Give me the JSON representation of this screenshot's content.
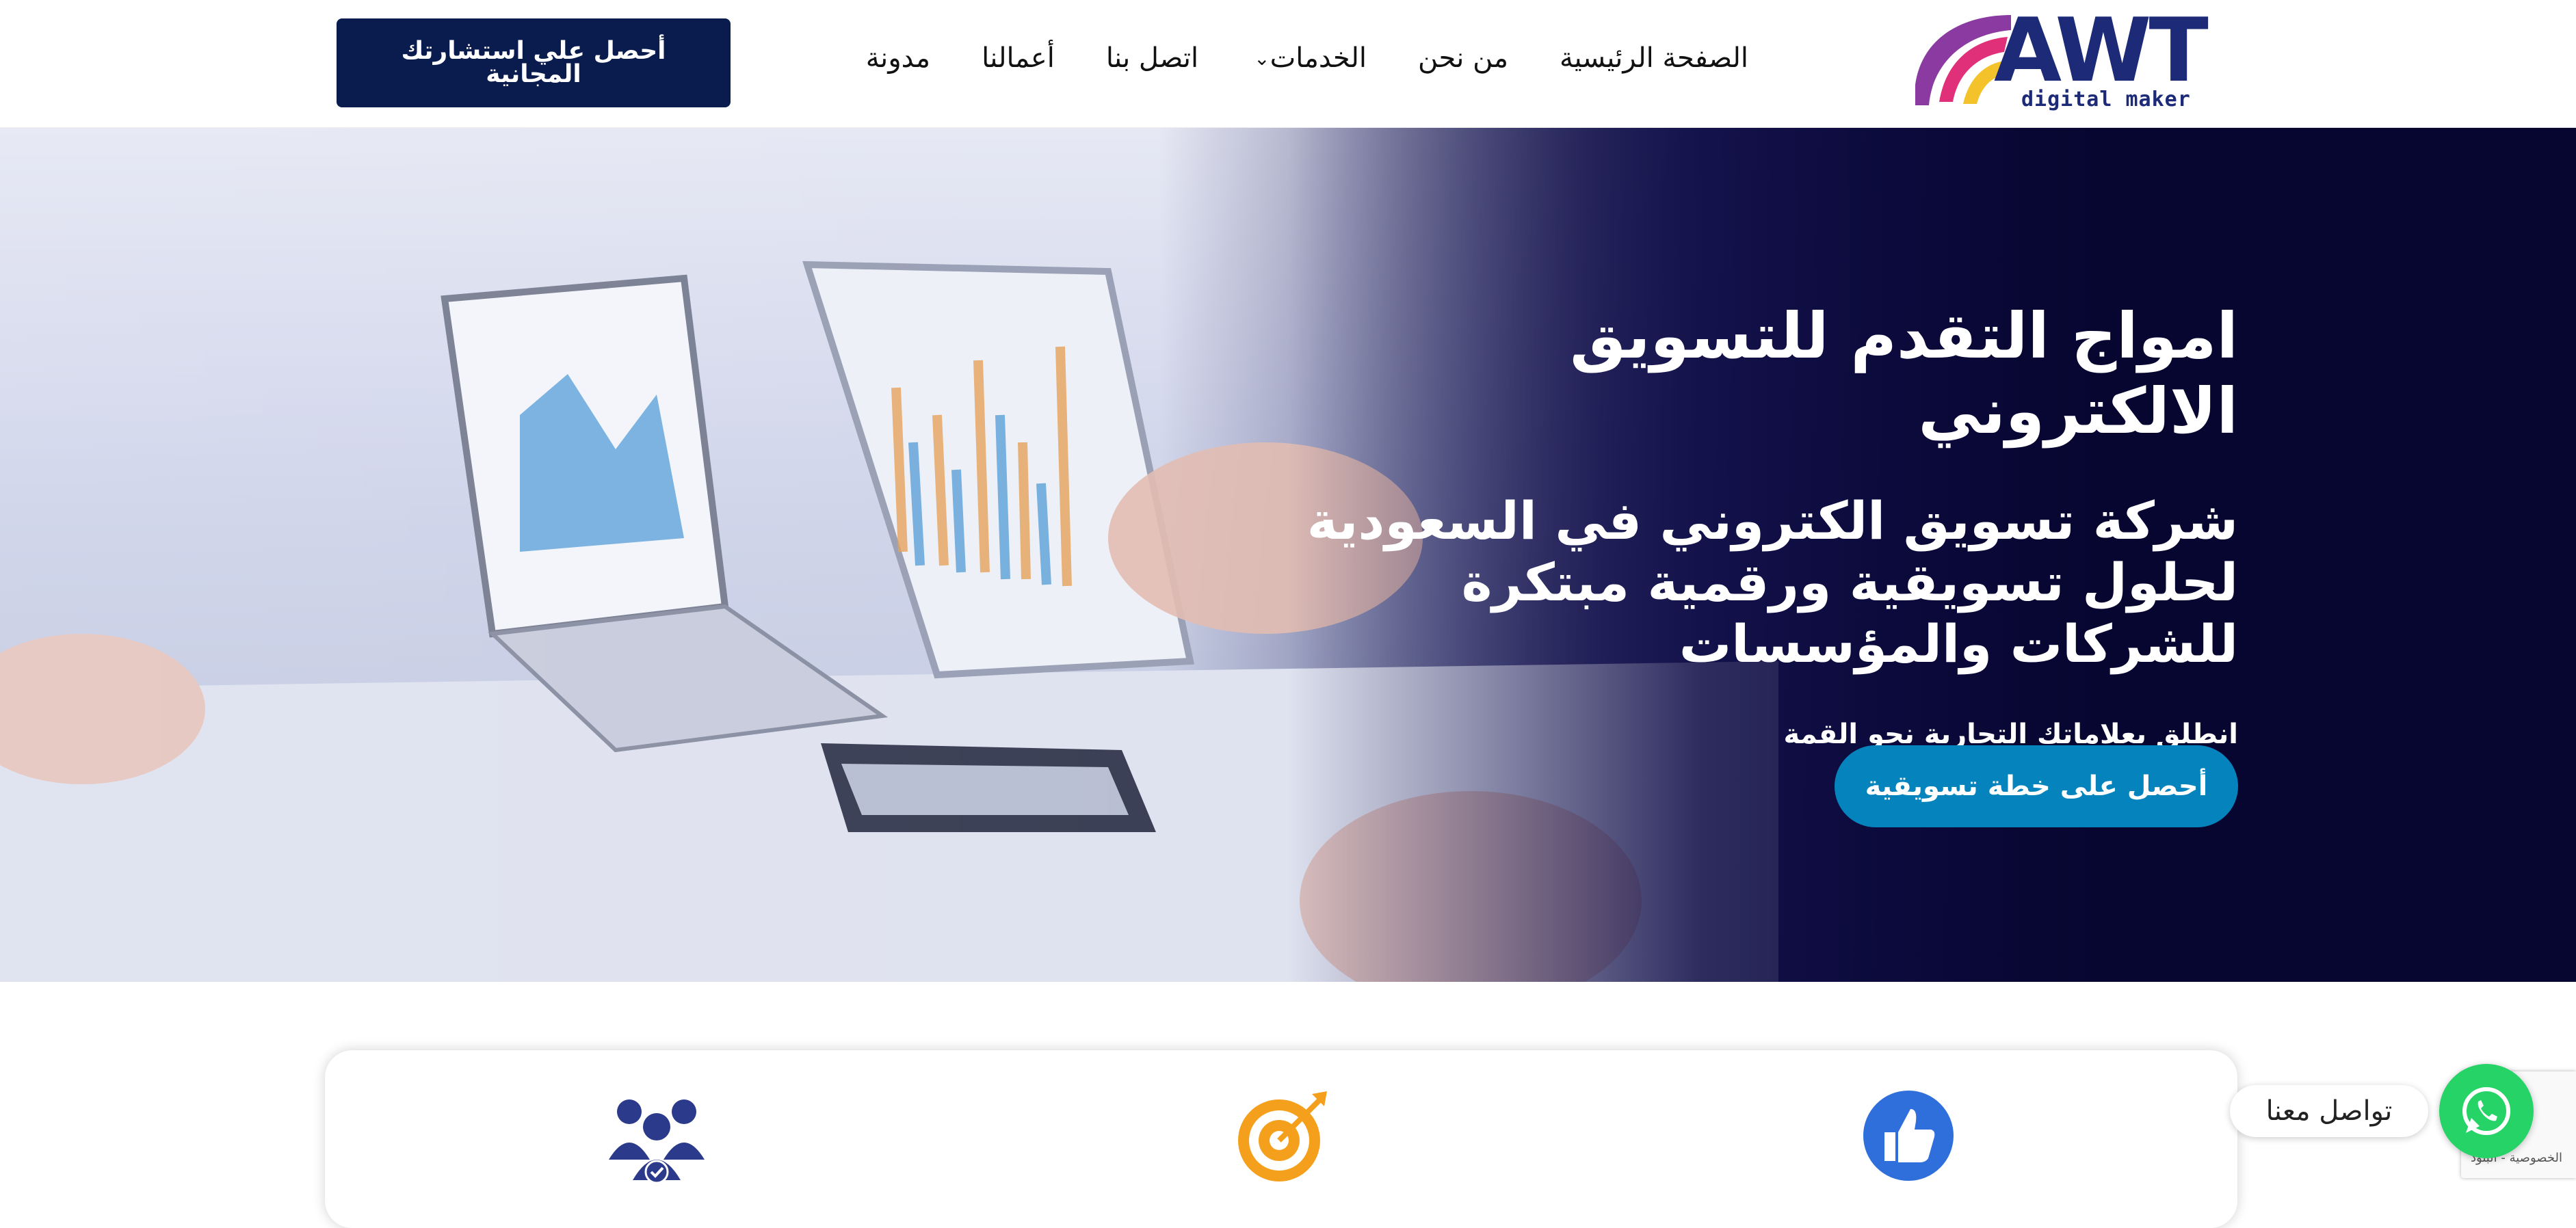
{
  "brand": {
    "name": "AWT",
    "tagline": "digital maker",
    "colors": {
      "navy": "#1c2a78",
      "purple": "#8a3aa0",
      "pink": "#e0307a",
      "yellow": "#f4c22b"
    }
  },
  "nav": {
    "items": [
      {
        "label": "الصفحة الرئيسية"
      },
      {
        "label": "من نحن"
      },
      {
        "label": "الخدمات",
        "icon": "chevron-down-icon"
      },
      {
        "label": "اتصل بنا"
      },
      {
        "label": "أعمالنا"
      },
      {
        "label": "مدونة"
      }
    ],
    "cta_label": "أحصل علي استشارتك المجانية"
  },
  "hero": {
    "title": "امواج التقدم للتسويق الالكتروني",
    "subtitle": "شركة تسويق الكتروني في السعودية لحلول تسويقية ورقمية مبتكرة للشركات والمؤسسات",
    "tagline": "انطلق بعلاماتك التجارية نحو القمة",
    "button_label": "أحصل على خطة تسويقية",
    "button_color": "#0583bd"
  },
  "features": {
    "icons": [
      {
        "name": "team-icon",
        "color": "#2b3a8a"
      },
      {
        "name": "target-icon",
        "color": "#f4a01c"
      },
      {
        "name": "thumbs-up-icon",
        "color": "#2f6fdc"
      }
    ]
  },
  "floating": {
    "contact_label": "تواصل معنا",
    "whatsapp_icon": "whatsapp-icon",
    "whatsapp_color": "#25d366",
    "recaptcha_text": "الخصوصية - البنود"
  }
}
